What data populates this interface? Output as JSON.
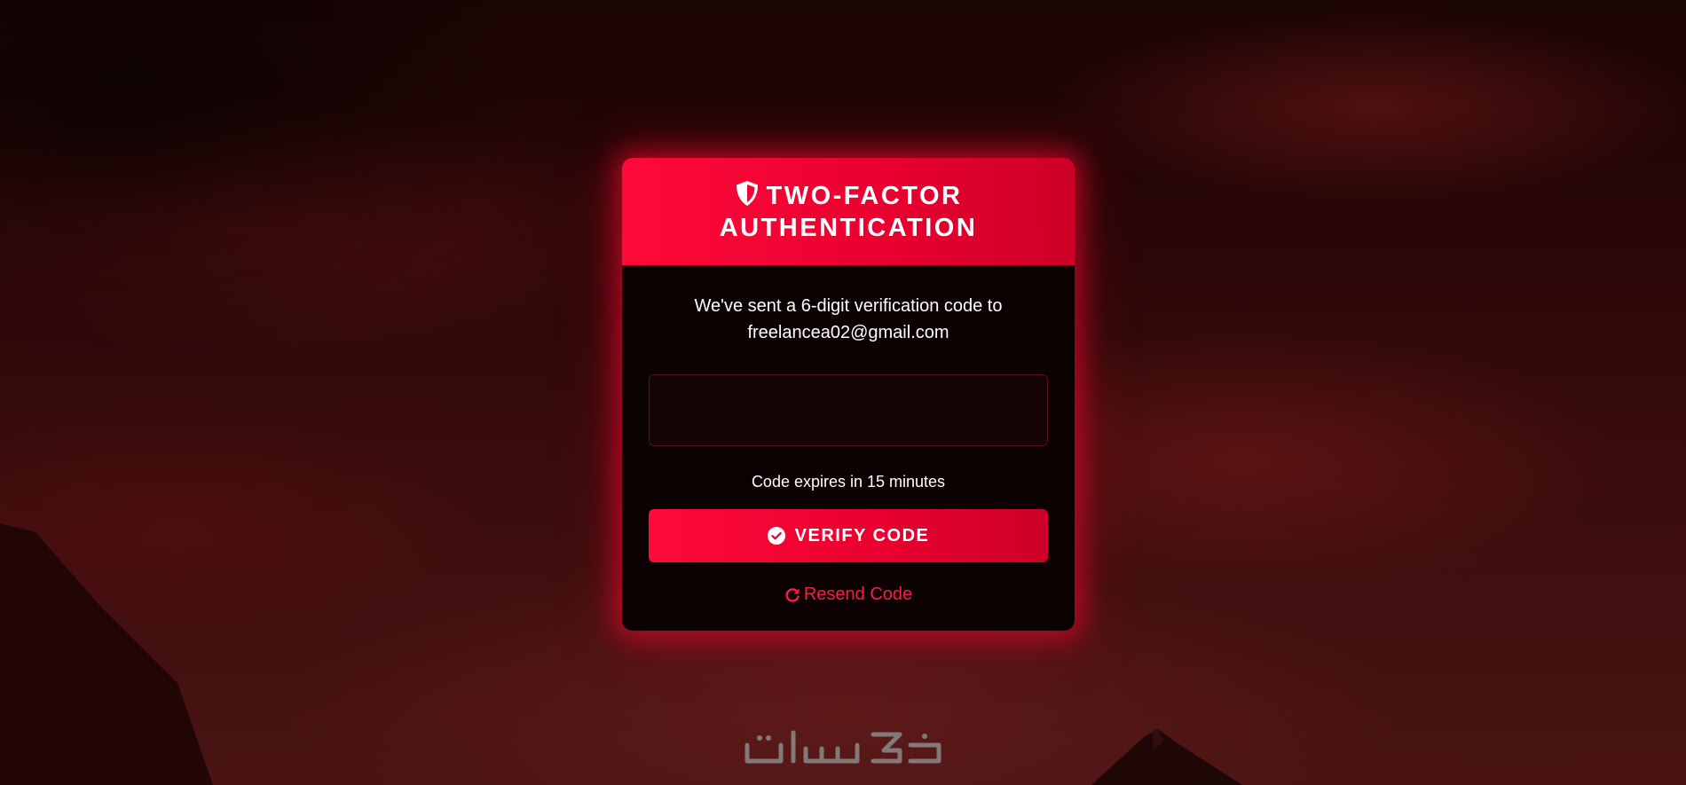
{
  "header": {
    "title": "TWO-FACTOR AUTHENTICATION",
    "icon": "shield-icon"
  },
  "message": {
    "line1": "We've sent a 6-digit verification code to",
    "email": "freelancea02@gmail.com"
  },
  "code_input": {
    "value": "",
    "placeholder": ""
  },
  "expiry_text": "Code expires in 15 minutes",
  "verify_button": {
    "label": "VERIFY CODE",
    "icon": "check-circle-icon"
  },
  "resend_link": {
    "label": "Resend Code",
    "icon": "refresh-icon"
  },
  "watermark": {
    "text": "خمسات"
  },
  "colors": {
    "accent": "#ff0a3a",
    "accent_dark": "#cc0028",
    "card_bg": "#0d0202",
    "link": "#ff1a45"
  }
}
